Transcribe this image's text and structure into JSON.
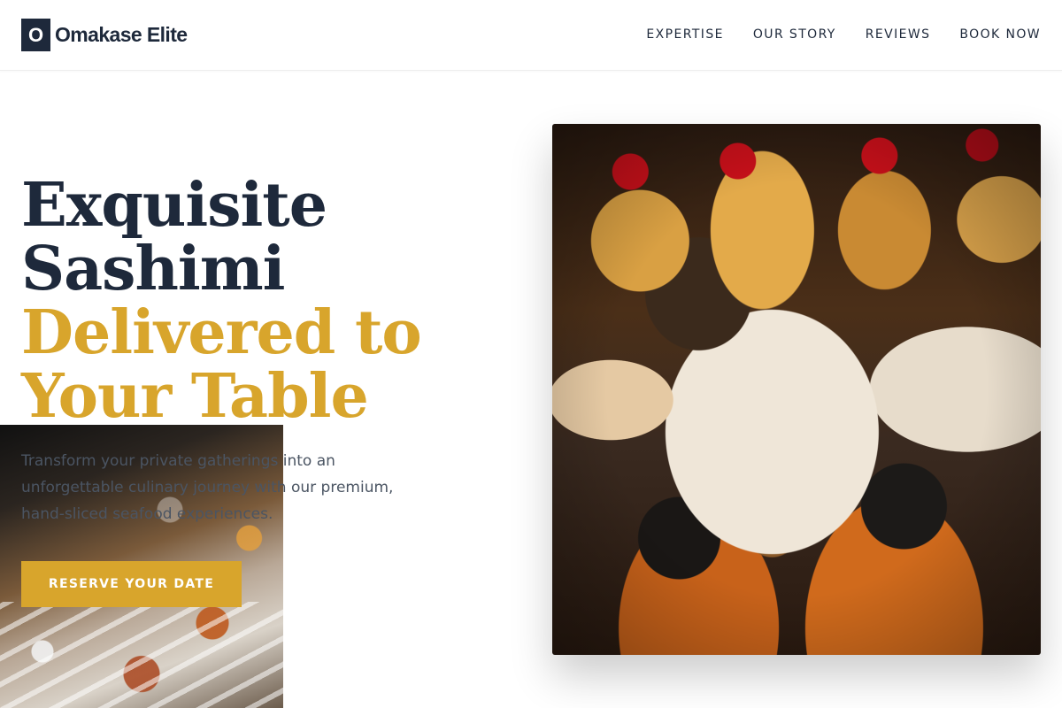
{
  "brand": {
    "logo_letter": "O",
    "name": "Omakase Elite"
  },
  "nav": {
    "items": [
      "EXPERTISE",
      "OUR STORY",
      "REVIEWS",
      "BOOK NOW"
    ]
  },
  "hero": {
    "title_line1": "Exquisite",
    "title_line2": "Sashimi",
    "title_line3": "Delivered to",
    "title_line4": "Your Table",
    "subtitle": "Transform your private gatherings into an unforgettable culinary journey with our premium, hand-sliced seafood experiences.",
    "cta_label": "RESERVE YOUR DATE"
  },
  "colors": {
    "navy": "#1e293b",
    "gold": "#d8a52c",
    "body_text": "#4b5563"
  }
}
